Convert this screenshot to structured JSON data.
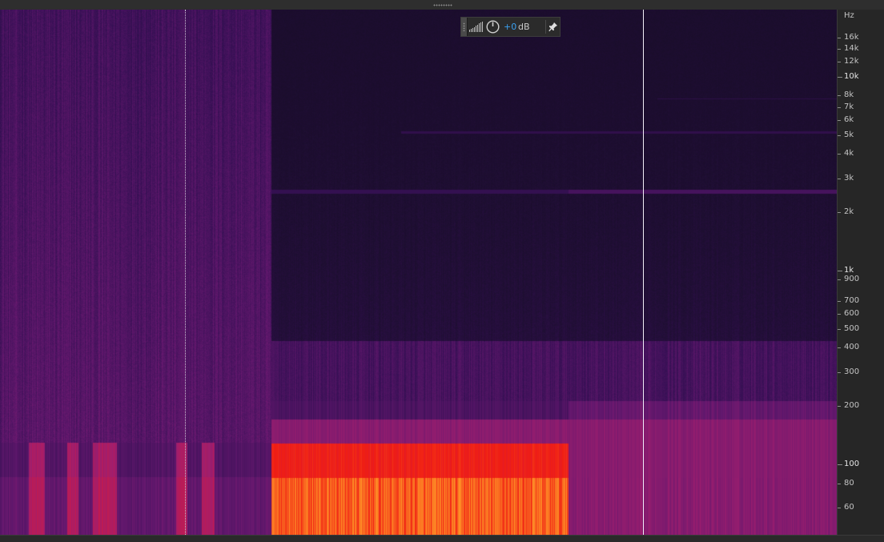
{
  "hud": {
    "gain_value": "+0",
    "gain_unit": "dB",
    "icons": [
      "level-meter-icon",
      "gain-knob-icon",
      "pin-icon"
    ]
  },
  "ruler": {
    "unit_label": "Hz",
    "labels": [
      {
        "text": "16k",
        "hz": 16000,
        "major": false
      },
      {
        "text": "14k",
        "hz": 14000,
        "major": false
      },
      {
        "text": "12k",
        "hz": 12000,
        "major": false
      },
      {
        "text": "10k",
        "hz": 10000,
        "major": true
      },
      {
        "text": "8k",
        "hz": 8000,
        "major": false
      },
      {
        "text": "7k",
        "hz": 7000,
        "major": false
      },
      {
        "text": "6k",
        "hz": 6000,
        "major": false
      },
      {
        "text": "5k",
        "hz": 5000,
        "major": false
      },
      {
        "text": "4k",
        "hz": 4000,
        "major": false
      },
      {
        "text": "3k",
        "hz": 3000,
        "major": false
      },
      {
        "text": "2k",
        "hz": 2000,
        "major": false
      },
      {
        "text": "1k",
        "hz": 1000,
        "major": true
      },
      {
        "text": "900",
        "hz": 900,
        "major": false
      },
      {
        "text": "700",
        "hz": 700,
        "major": false
      },
      {
        "text": "600",
        "hz": 600,
        "major": false
      },
      {
        "text": "500",
        "hz": 500,
        "major": false
      },
      {
        "text": "400",
        "hz": 400,
        "major": false
      },
      {
        "text": "300",
        "hz": 300,
        "major": false
      },
      {
        "text": "200",
        "hz": 200,
        "major": false
      },
      {
        "text": "100",
        "hz": 100,
        "major": true
      },
      {
        "text": "80",
        "hz": 80,
        "major": false
      },
      {
        "text": "60",
        "hz": 60,
        "major": false
      }
    ]
  },
  "colors": {
    "background": "#150d1f",
    "low_energy": "#2a0f45",
    "mid_energy": "#8a1f7a",
    "high_energy": "#e01a1a",
    "peak_energy": "#ff9a2a",
    "playhead": "#f2eef8",
    "hud_value": "#3aa0f0"
  }
}
